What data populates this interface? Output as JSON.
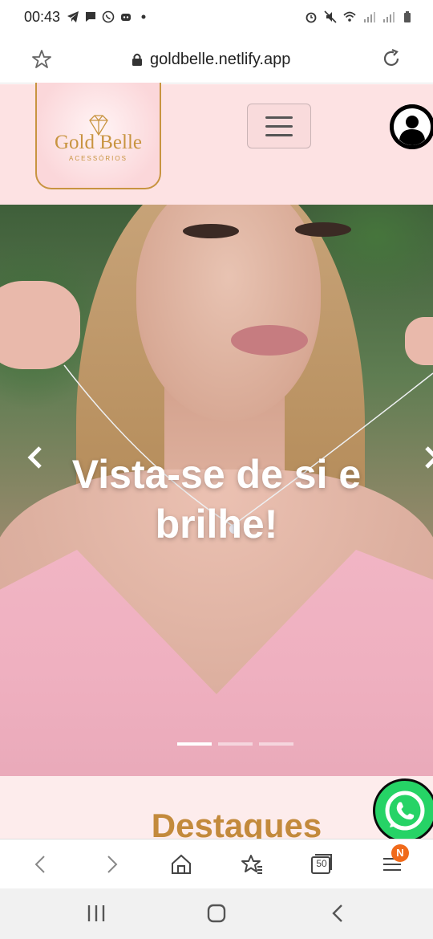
{
  "status_bar": {
    "time": "00:43",
    "left_icons": [
      "telegram-icon",
      "message-icon",
      "whatsapp-icon",
      "discord-icon",
      "dot-icon"
    ],
    "right_icons": [
      "alarm-icon",
      "mute-icon",
      "wifi-icon",
      "signal-icon",
      "signal-icon",
      "battery-icon"
    ]
  },
  "browser": {
    "url": "goldbelle.netlify.app",
    "tab_count": "50",
    "notification_badge": "N"
  },
  "header": {
    "logo_name": "Gold Belle",
    "logo_subtitle": "ACESSÓRIOS"
  },
  "hero": {
    "caption": "Vista-se de si e brilhe!",
    "slides": 3,
    "active_slide": 0
  },
  "highlights": {
    "title": "Destaques"
  },
  "colors": {
    "header_bg": "#fde2e3",
    "gold": "#c89440",
    "title_gold": "#c38a3c",
    "whatsapp_green": "#26d366",
    "badge_orange": "#f06a1a"
  }
}
